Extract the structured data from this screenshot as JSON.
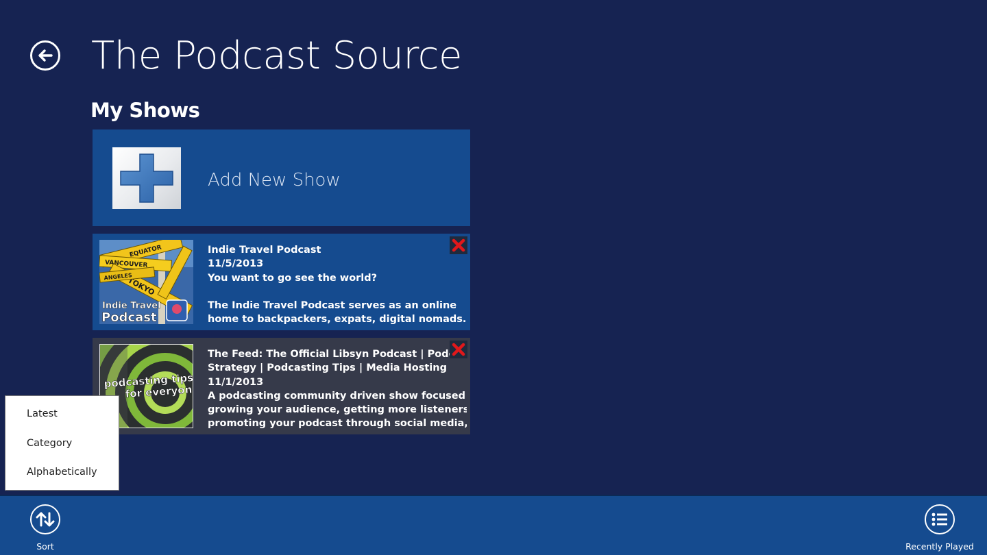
{
  "app": {
    "title": "The Podcast Source"
  },
  "header": {
    "back_icon": "back-arrow-icon"
  },
  "section": {
    "title": "My Shows"
  },
  "add_show": {
    "label": "Add New Show",
    "icon": "plus-icon"
  },
  "shows": [
    {
      "title": "Indie Travel Podcast",
      "date": "11/5/2013",
      "tagline": "You want to go see the world?",
      "description_lines": [
        "The Indie Travel Podcast serves as an online",
        "home to backpackers, expats, digital nomads..."
      ],
      "artwork_text": [
        "Indie Travel",
        "Podcast"
      ],
      "sign_words": [
        "EQUATOR",
        "VANCOUVER",
        "TOKYO",
        "ANGELES"
      ],
      "selected": true
    },
    {
      "title_lines": [
        "The Feed: The Official Libsyn Podcast | Podcast",
        "Strategy |  Podcasting Tips | Media Hosting"
      ],
      "date": "11/1/2013",
      "description_lines": [
        "A podcasting community driven show focused on",
        "growing your audience, getting more listeners,",
        "promoting your podcast through social media,..."
      ],
      "artwork_text": [
        "podcasting tips",
        "for everyone"
      ],
      "selected": false
    }
  ],
  "sort_menu": {
    "items": [
      "Latest",
      "Category",
      "Alphabetically"
    ]
  },
  "app_bar": {
    "sort_label": "Sort",
    "recently_played_label": "Recently Played"
  },
  "colors": {
    "background": "#162352",
    "tile_selected": "#154b8f",
    "tile_plain": "#363a4a",
    "app_bar": "#154b8f",
    "remove_red": "#e0181b",
    "plus_blue": "#3a74b8"
  }
}
